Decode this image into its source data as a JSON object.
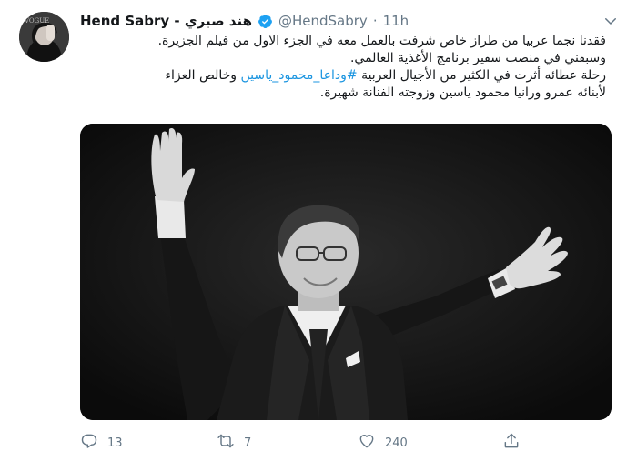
{
  "tweet": {
    "display_name": "Hend Sabry - هند صبري",
    "handle": "@HendSabry",
    "separator": "·",
    "time": "11h",
    "text_lines": [
      "فقدنا نجما عربيا من طراز خاص شرفت بالعمل معه في الجزء الاول من فيلم الجزيرة.",
      "وسبقني في منصب سفير برنامج الأغذية العالمي.",
      "رحلة عطائه أثرت في الكثير من الأجيال العربية",
      "#وداعا_محمود_ياسين",
      "وخالص العزاء",
      "لأبنائه عمرو ورانيا محمود ياسين وزوجته الفنانة شهيرة."
    ]
  },
  "actions": {
    "reply_count": "13",
    "retweet_count": "7",
    "like_count": "240"
  },
  "icons": {
    "verified": "verified-badge-icon",
    "caret": "chevron-down-icon",
    "reply": "reply-icon",
    "retweet": "retweet-icon",
    "like": "heart-icon",
    "share": "share-icon"
  },
  "colors": {
    "accent": "#1da1f2",
    "hashtag": "#1b95e0",
    "muted": "#657786"
  }
}
